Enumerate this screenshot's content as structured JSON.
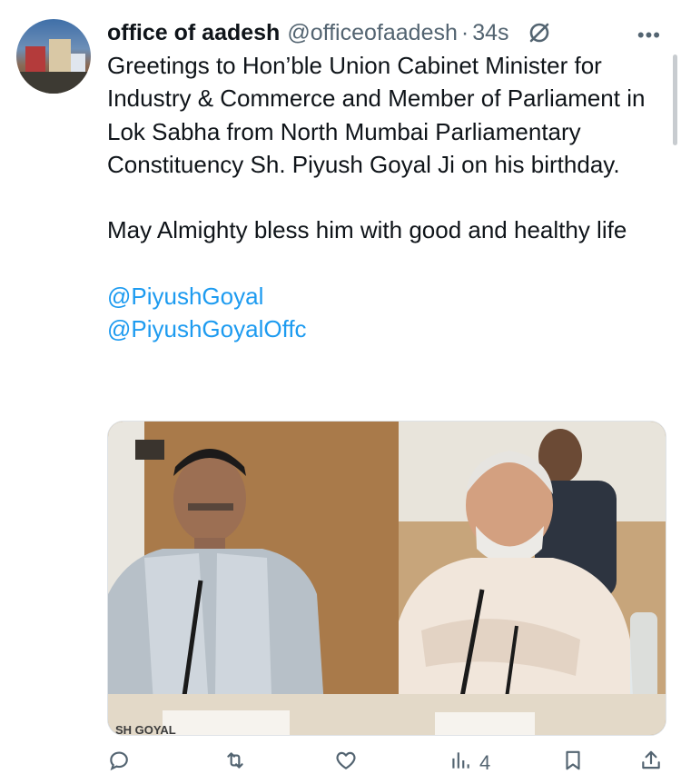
{
  "tweet": {
    "author_name": "office of aadesh",
    "handle": "@officeofaadesh",
    "separator": "·",
    "time": "34s",
    "paragraphs": [
      "Greetings to Hon’ble Union Cabinet Minister for Industry & Commerce and Member of Parliament in Lok Sabha from North Mumbai Parliamentary Constituency Sh. Piyush Goyal Ji on his birthday.",
      "May Almighty bless him with good and healthy life"
    ],
    "mentions": [
      "@PiyushGoyal",
      "@PiyushGoyalOffc"
    ],
    "photo_caption_text": "SH GOYAL"
  },
  "actions": {
    "reply_icon": "reply-icon",
    "retweet_icon": "retweet-icon",
    "like_icon": "heart-icon",
    "views_icon": "views-icon",
    "views_count": "4",
    "bookmark_icon": "bookmark-icon",
    "share_icon": "share-icon"
  },
  "colors": {
    "text": "#0f1419",
    "secondary": "#536471",
    "link": "#1d9bf0"
  }
}
